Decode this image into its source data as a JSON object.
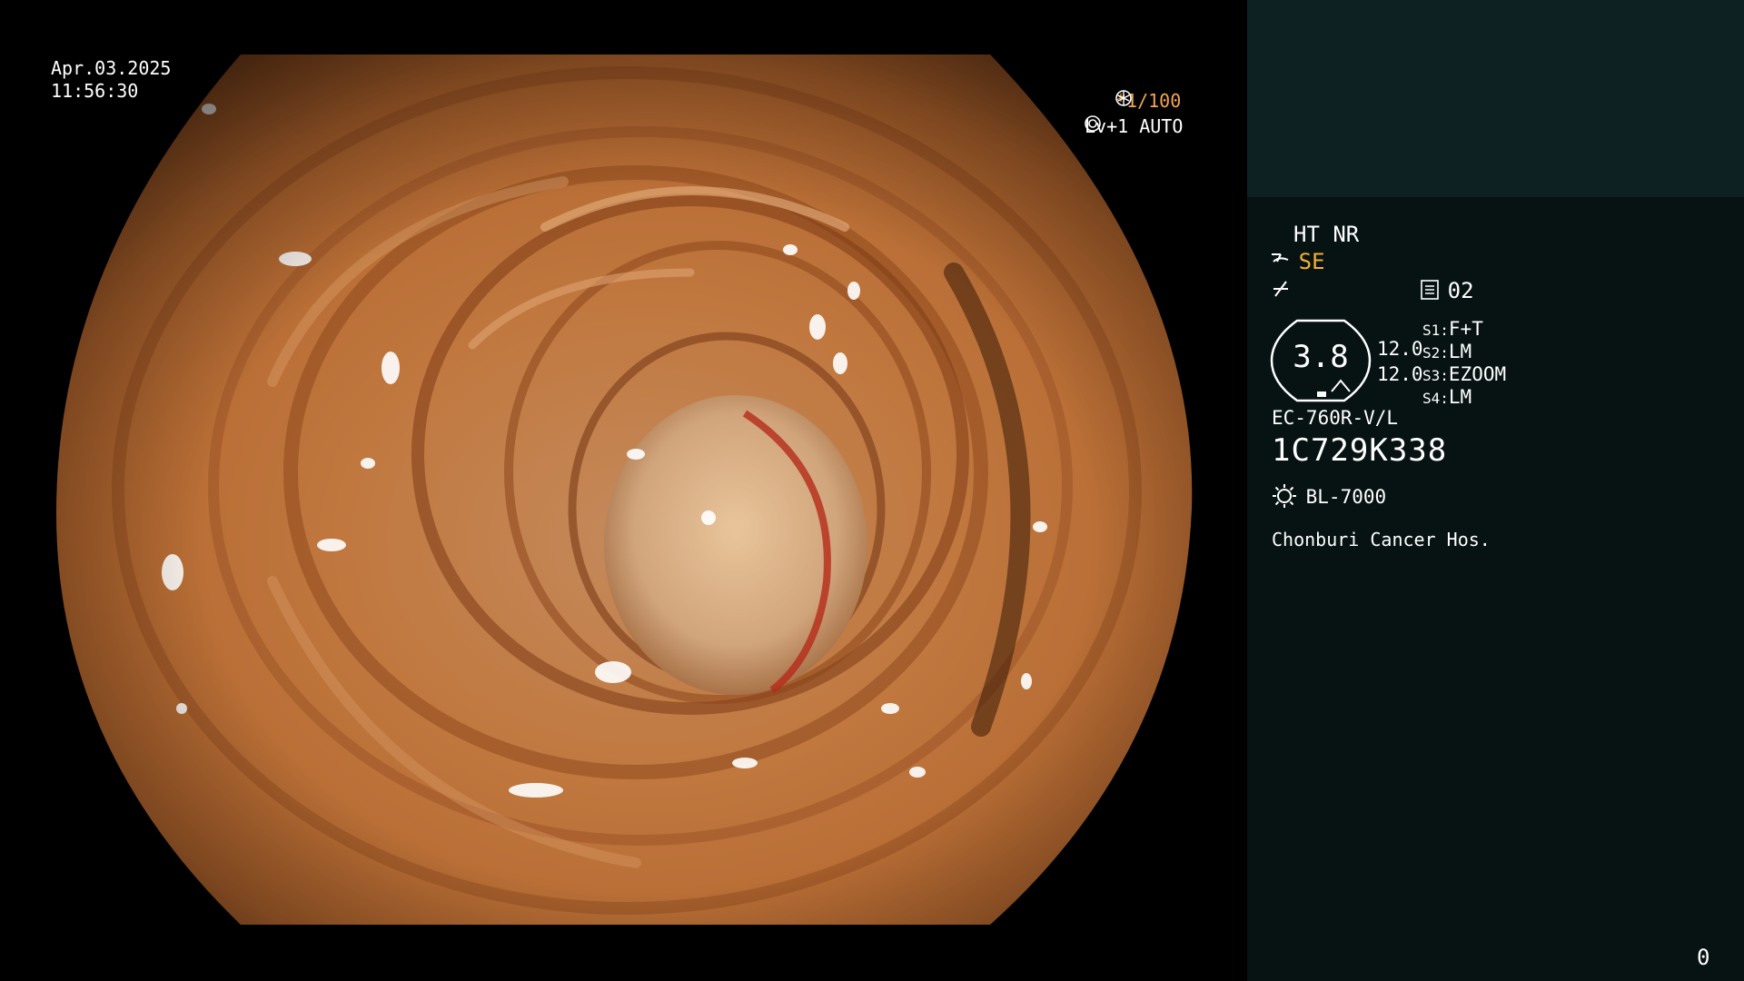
{
  "overlay": {
    "date": "Apr.03.2025",
    "time": "11:56:30",
    "shutter": "*1/100",
    "shutter_icon": "shutter-icon",
    "level": "Lv+1 AUTO",
    "level_icon": "iris-icon"
  },
  "panel": {
    "ht_nr": "HT NR",
    "se": "SE",
    "se_icon": "structure-enhance-icon",
    "color_icon": "color-mode-icon",
    "memory_icon": "memory-icon",
    "memory_value": "02",
    "dial_value": "3.8",
    "value1": "12.0",
    "value2": "12.0",
    "switches": [
      {
        "key": "S1:",
        "val": "F+T"
      },
      {
        "key": "S2:",
        "val": "LM"
      },
      {
        "key": "S3:",
        "val": "EZOOM"
      },
      {
        "key": "S4:",
        "val": "LM"
      }
    ],
    "scope_model": "EC-760R-V/L",
    "serial": "1C729K338",
    "light_icon": "light-source-icon",
    "light_source": "BL-7000",
    "hospital": "Chonburi Cancer Hos.",
    "counter": "0"
  },
  "colors": {
    "panel_bg": "#071212",
    "panel_top_bg": "#0e2122",
    "accent_yellow": "#f3b02e",
    "shutter_orange": "#f3a64a"
  }
}
